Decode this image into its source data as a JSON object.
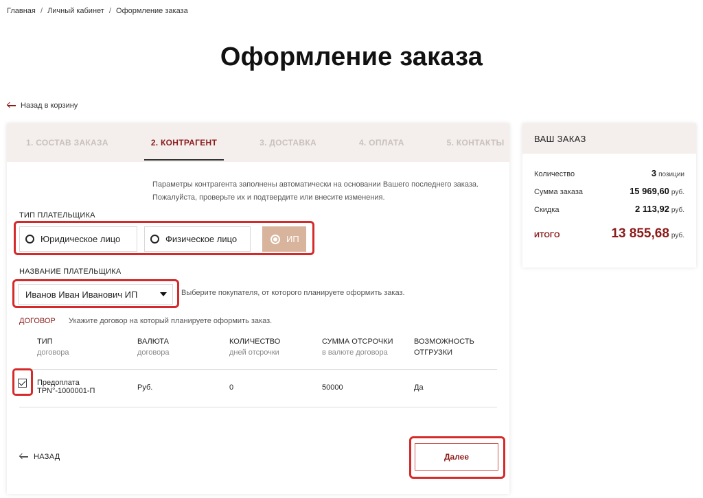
{
  "breadcrumb": {
    "home": "Главная",
    "account": "Личный кабинет",
    "current": "Оформление заказа",
    "separator": "/"
  },
  "page_title": "Оформление заказа",
  "back_to_cart": "Назад в корзину",
  "steps": [
    {
      "label": "1. СОСТАВ ЗАКАЗА",
      "active": false
    },
    {
      "label": "2. КОНТРАГЕНТ",
      "active": true
    },
    {
      "label": "3. ДОСТАВКА",
      "active": false
    },
    {
      "label": "4. ОПЛАТА",
      "active": false
    },
    {
      "label": "5. КОНТАКТЫ",
      "active": false
    }
  ],
  "info": {
    "line1": "Параметры контрагента заполнены автоматически на основании Вашего последнего заказа.",
    "line2": "Пожалуйста, проверьте их и подтвердите или внесите изменения."
  },
  "payer_type": {
    "label": "ТИП ПЛАТЕЛЬЩИКА",
    "options": [
      "Юридическое лицо",
      "Физическое лицо",
      "ИП"
    ],
    "selected": "ИП"
  },
  "payer_name": {
    "label": "НАЗВАНИЕ ПЛАТЕЛЬЩИКА",
    "value": "Иванов Иван Иванович ИП",
    "hint": "Выберите покупателя, от которого планируете оформить заказ."
  },
  "contract": {
    "label": "ДОГОВОР",
    "hint": "Укажите договор на который планируете оформить заказ.",
    "columns": [
      {
        "title": "ТИП",
        "sub": "договора"
      },
      {
        "title": "ВАЛЮТА",
        "sub": "договора"
      },
      {
        "title": "КОЛИЧЕСТВО",
        "sub": "дней отсрочки"
      },
      {
        "title": "СУММА ОТСРОЧКИ",
        "sub": "в валюте договора"
      },
      {
        "title": "ВОЗМОЖНОСТЬ",
        "sub": "ОТГРУЗКИ"
      }
    ],
    "rows": [
      {
        "type_line1": "Предоплата",
        "type_line2": "ТРN°-1000001-П",
        "currency": "Руб.",
        "days": "0",
        "amount": "50000",
        "shipping": "Да",
        "checked": true
      }
    ]
  },
  "nav": {
    "back": "НАЗАД",
    "next": "Далее"
  },
  "order": {
    "title": "ВАШ ЗАКАЗ",
    "quantity_label": "Количество",
    "quantity_value": "3",
    "quantity_unit": "позиции",
    "sum_label": "Сумма заказа",
    "sum_value": "15 969,60",
    "sum_unit": "руб.",
    "discount_label": "Скидка",
    "discount_value": "2 113,92",
    "discount_unit": "руб.",
    "total_label": "ИТОГО",
    "total_value": "13 855,68",
    "total_unit": "руб."
  }
}
